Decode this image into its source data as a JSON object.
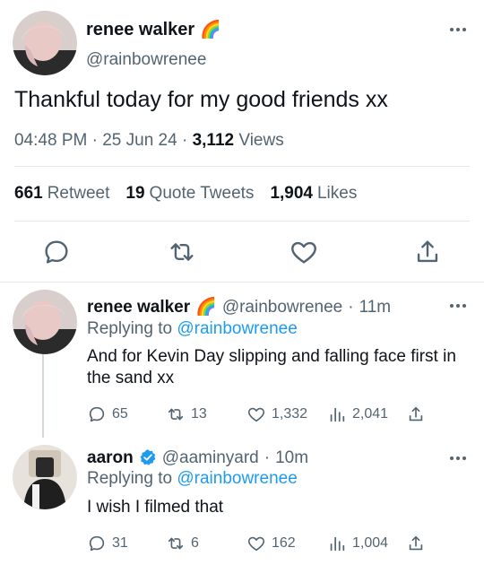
{
  "main_tweet": {
    "name": "renee walker",
    "name_emoji": "🌈",
    "handle": "@rainbowrenee",
    "text": "Thankful today for my good friends xx",
    "time": "04:48 PM",
    "date": "25 Jun 24",
    "views_count": "3,112",
    "views_label": "Views",
    "retweets_count": "661",
    "retweets_label": "Retweet",
    "quotes_count": "19",
    "quotes_label": "Quote Tweets",
    "likes_count": "1,904",
    "likes_label": "Likes"
  },
  "replies": [
    {
      "name": "renee walker",
      "name_emoji": "🌈",
      "handle": "@rainbowrenee",
      "age": "11m",
      "replying_prefix": "Replying to",
      "replying_to": "@rainbowrenee",
      "text": "And for Kevin Day slipping and falling face first in the sand xx",
      "replies": "65",
      "retweets": "13",
      "likes": "1,332",
      "views": "2,041"
    },
    {
      "name": "aaron",
      "verified": true,
      "handle": "@aaminyard",
      "age": "10m",
      "replying_prefix": "Replying to",
      "replying_to": "@rainbowrenee",
      "text": "I wish I filmed that",
      "replies": "31",
      "retweets": "6",
      "likes": "162",
      "views": "1,004"
    }
  ],
  "colors": {
    "text": "#0f1419",
    "secondary": "#536471",
    "link": "#1d9bf0",
    "divider": "#e6e9eb",
    "verified": "#1d9bf0"
  },
  "icons": [
    "more-icon",
    "reply-icon",
    "retweet-icon",
    "like-icon",
    "share-icon",
    "views-icon",
    "verified-icon"
  ]
}
